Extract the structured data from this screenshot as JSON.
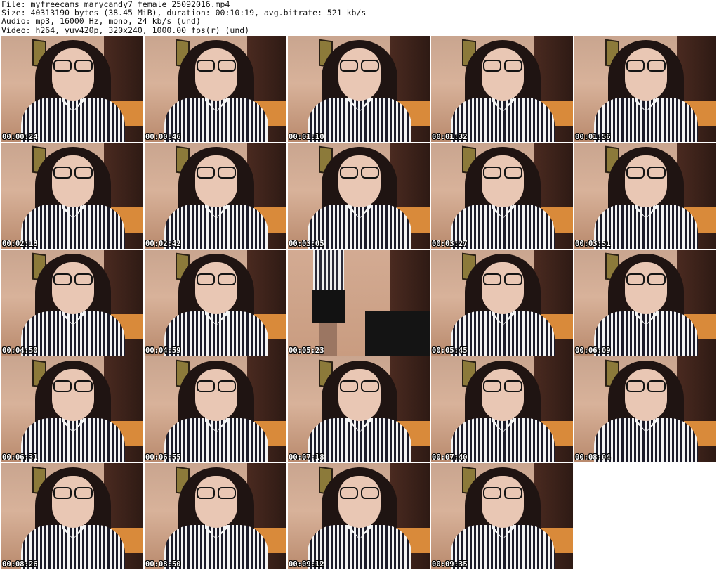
{
  "header": {
    "file_line": "File: myfreecams_marycandy7_female_25092016.mp4",
    "size_line": "Size: 40313190 bytes (38.45 MiB), duration: 00:10:19, avg.bitrate: 521 kb/s",
    "audio_line": "Audio: mp3, 16000 Hz, mono, 24 kb/s (und)",
    "video_line": "Video: h264, yuv420p, 320x240, 1000.00 fps(r) (und)"
  },
  "thumbnails": [
    {
      "time": "00:00:24"
    },
    {
      "time": "00:00:46"
    },
    {
      "time": "00:01:10"
    },
    {
      "time": "00:01:32"
    },
    {
      "time": "00:01:56"
    },
    {
      "time": "00:02:18"
    },
    {
      "time": "00:02:42"
    },
    {
      "time": "00:03:05"
    },
    {
      "time": "00:03:27"
    },
    {
      "time": "00:03:51"
    },
    {
      "time": "00:04:50"
    },
    {
      "time": "00:04:59"
    },
    {
      "time": "00:05:23"
    },
    {
      "time": "00:05:45"
    },
    {
      "time": "00:06:09"
    },
    {
      "time": "00:06:31"
    },
    {
      "time": "00:06:55"
    },
    {
      "time": "00:07:18"
    },
    {
      "time": "00:07:40"
    },
    {
      "time": "00:08:04"
    },
    {
      "time": "00:08:26"
    },
    {
      "time": "00:08:50"
    },
    {
      "time": "00:09:12"
    },
    {
      "time": "00:09:35"
    }
  ]
}
